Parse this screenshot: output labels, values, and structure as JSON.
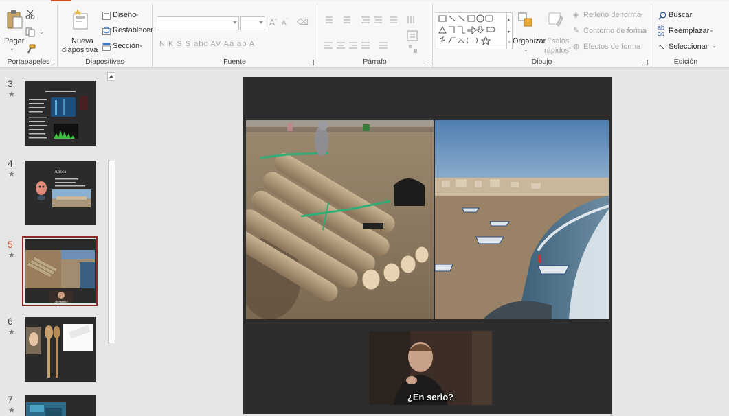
{
  "ribbon": {
    "groups": {
      "clipboard": {
        "label": "Portapapeles",
        "paste": "Pegar"
      },
      "slides": {
        "label": "Diapositivas",
        "new_slide": "Nueva",
        "new_slide_2": "diapositiva",
        "layout": "Diseño",
        "reset": "Restablecer",
        "section": "Sección"
      },
      "font": {
        "label": "Fuente",
        "font_name_value": "",
        "font_size_value": "",
        "format_letters": "N  K  S  S  abc  AV  Aa  ab  A"
      },
      "paragraph": {
        "label": "Párrafo"
      },
      "drawing": {
        "label": "Dibujo",
        "arrange": "Organizar",
        "quick_styles_1": "Estilos",
        "quick_styles_2": "rápidos",
        "shape_fill": "Relleno de forma",
        "shape_outline": "Contorno de forma",
        "shape_effects": "Efectos de forma"
      },
      "editing": {
        "label": "Edición",
        "find": "Buscar",
        "replace": "Reemplazar",
        "select": "Seleccionar"
      }
    }
  },
  "thumbnails": {
    "items": [
      {
        "number": "3",
        "star": "★",
        "active": false
      },
      {
        "number": "4",
        "star": "★",
        "active": false,
        "title": "Ahora"
      },
      {
        "number": "5",
        "star": "★",
        "active": true,
        "caption": "¿En serio?"
      },
      {
        "number": "6",
        "star": "★",
        "active": false
      },
      {
        "number": "7",
        "star": "★",
        "active": false
      }
    ]
  },
  "slide": {
    "video_subtitle": "¿En serio?"
  },
  "colors": {
    "accent": "#c8502a",
    "selection_border": "#8c2a2a",
    "slide_background": "#2d2d2d"
  }
}
